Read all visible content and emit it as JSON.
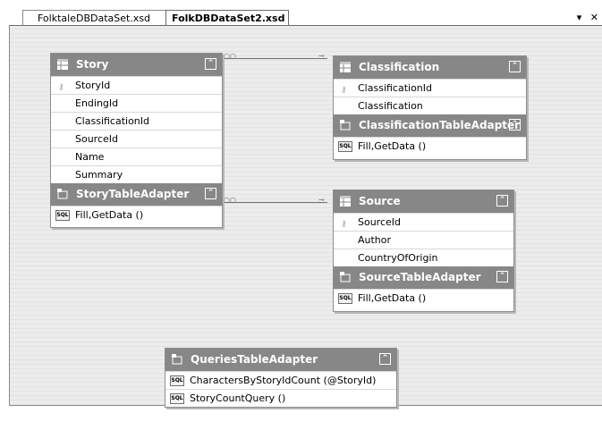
{
  "tabs": [
    {
      "label": "FolktaleDBDataSet.xsd",
      "active": false
    },
    {
      "label": "FolkDBDataSet2.xsd",
      "active": true
    }
  ],
  "window_controls": {
    "dropdown": "▾",
    "close": "✕"
  },
  "story": {
    "title": "Story",
    "columns": [
      "StoryId",
      "EndingId",
      "ClassificationId",
      "SourceId",
      "Name",
      "Summary"
    ],
    "adapter_title": "StoryTableAdapter",
    "queries": [
      "Fill,GetData ()"
    ]
  },
  "classification": {
    "title": "Classification",
    "columns": [
      "ClassificationId",
      "Classification"
    ],
    "adapter_title": "ClassificationTableAdapter",
    "queries": [
      "Fill,GetData ()"
    ]
  },
  "source": {
    "title": "Source",
    "columns": [
      "SourceId",
      "Author",
      "CountryOfOrigin"
    ],
    "adapter_title": "SourceTableAdapter",
    "queries": [
      "Fill,GetData ()"
    ]
  },
  "queries_adapter": {
    "title": "QueriesTableAdapter",
    "queries": [
      "CharactersByStoryIdCount (@StoryId)",
      "StoryCountQuery ()"
    ]
  },
  "icons": {
    "key": "key-icon",
    "table": "table-icon",
    "adapter": "adapter-icon",
    "sql": "sql-icon",
    "collapse": "collapse-chevron-icon"
  },
  "sql_label": "SQL"
}
